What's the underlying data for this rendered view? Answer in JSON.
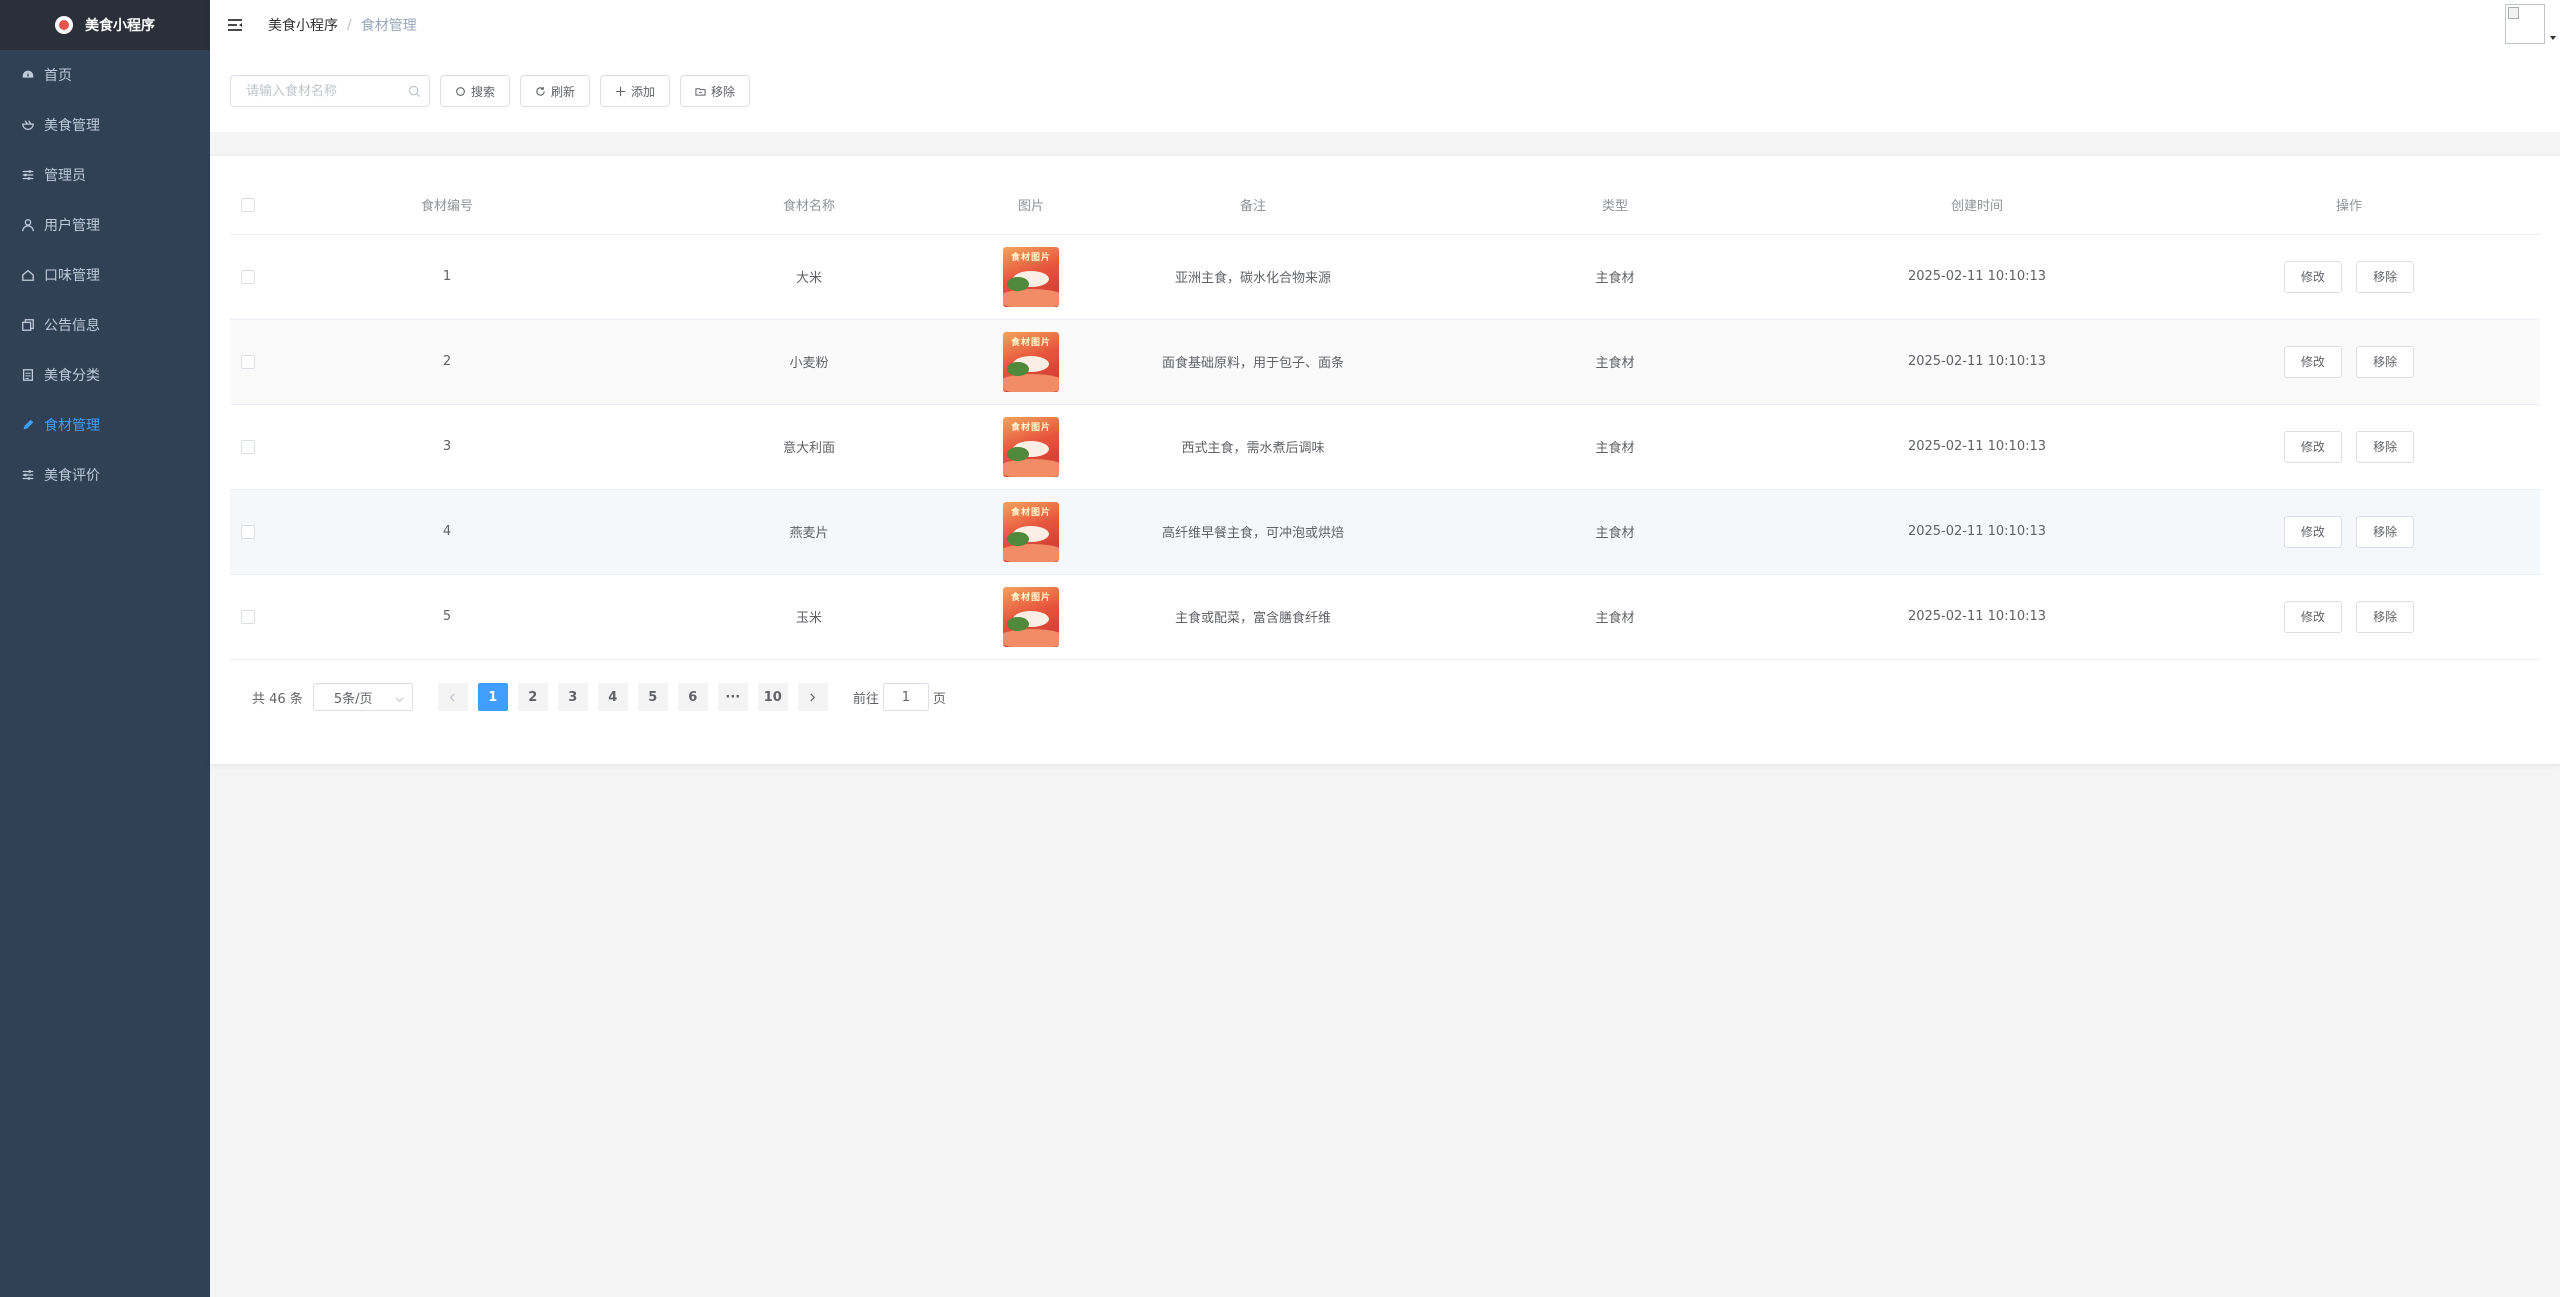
{
  "app": {
    "title": "美食小程序"
  },
  "sidebar": {
    "items": [
      {
        "label": "首页",
        "icon": "dashboard-icon",
        "active": false
      },
      {
        "label": "美食管理",
        "icon": "bowl-icon",
        "active": false
      },
      {
        "label": "管理员",
        "icon": "sliders-icon",
        "active": false
      },
      {
        "label": "用户管理",
        "icon": "user-icon",
        "active": false
      },
      {
        "label": "口味管理",
        "icon": "home-icon",
        "active": false
      },
      {
        "label": "公告信息",
        "icon": "copy-icon",
        "active": false
      },
      {
        "label": "美食分类",
        "icon": "document-icon",
        "active": false
      },
      {
        "label": "食材管理",
        "icon": "pencil-icon",
        "active": true
      },
      {
        "label": "美食评价",
        "icon": "sliders-icon",
        "active": false
      }
    ],
    "active_color": "#409eff"
  },
  "breadcrumb": {
    "root": "美食小程序",
    "separator": "/",
    "current": "食材管理"
  },
  "search": {
    "placeholder": "请输入食材名称",
    "value": ""
  },
  "toolbar": {
    "search_label": "搜索",
    "refresh_label": "刷新",
    "add_label": "添加",
    "remove_label": "移除"
  },
  "table": {
    "columns": [
      "食材编号",
      "食材名称",
      "图片",
      "备注",
      "类型",
      "创建时间",
      "操作"
    ],
    "image_caption": "食材图片",
    "rows": [
      {
        "id": "1",
        "name": "大米",
        "note": "亚洲主食，碳水化合物来源",
        "type": "主食材",
        "created": "2025-02-11 10:10:13"
      },
      {
        "id": "2",
        "name": "小麦粉",
        "note": "面食基础原料，用于包子、面条",
        "type": "主食材",
        "created": "2025-02-11 10:10:13"
      },
      {
        "id": "3",
        "name": "意大利面",
        "note": "西式主食，需水煮后调味",
        "type": "主食材",
        "created": "2025-02-11 10:10:13"
      },
      {
        "id": "4",
        "name": "燕麦片",
        "note": "高纤维早餐主食，可冲泡或烘焙",
        "type": "主食材",
        "created": "2025-02-11 10:10:13"
      },
      {
        "id": "5",
        "name": "玉米",
        "note": "主食或配菜，富含膳食纤维",
        "type": "主食材",
        "created": "2025-02-11 10:10:13"
      }
    ],
    "edit_label": "修改",
    "delete_label": "移除"
  },
  "pagination": {
    "total_text": "共 46 条",
    "page_size": "5条/页",
    "pages": [
      "1",
      "2",
      "3",
      "4",
      "5",
      "6",
      "···",
      "10"
    ],
    "current_page": "1",
    "goto_prefix": "前往",
    "goto_value": "1",
    "goto_suffix": "页"
  }
}
